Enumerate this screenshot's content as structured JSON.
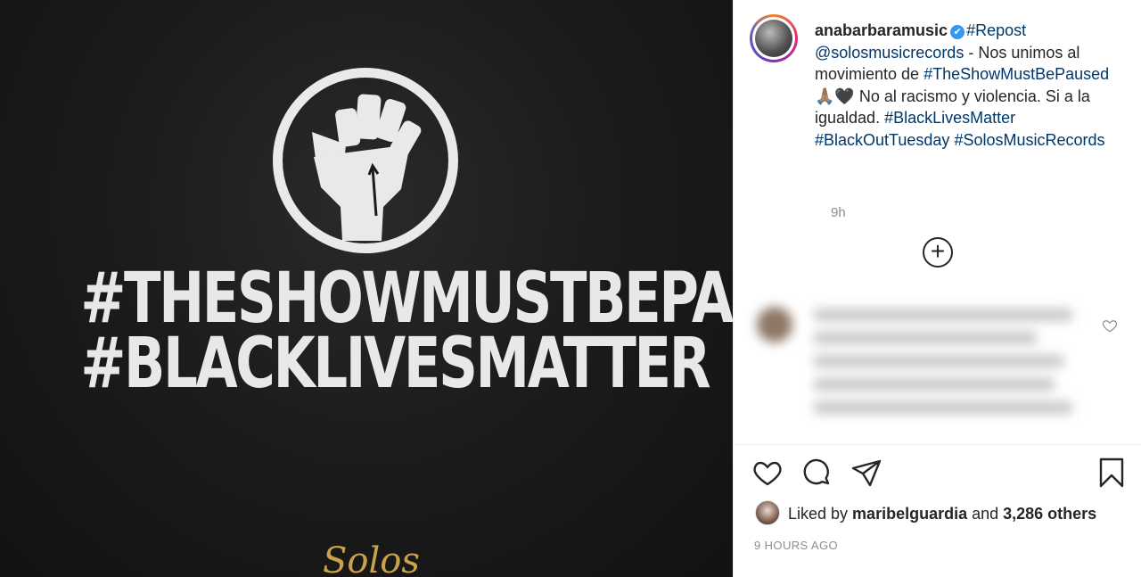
{
  "post_image": {
    "line1": "#THESHOWMUSTBEPAUSED",
    "line2": "#BLACKLIVESMATTER",
    "brand": "Solos"
  },
  "caption": {
    "username": "anabarbaramusic",
    "repost_tag": "#Repost",
    "mention": "@solosmusicrecords",
    "text1": " - Nos unimos al movimiento de ",
    "tag1": "#TheShowMustBePaused",
    "emoji": " 🙏🏽🖤 ",
    "text2": "No al racismo y violencia. Si a la igualdad. ",
    "tag2": "#BlackLivesMatter",
    "tag3": "#BlackOutTuesday",
    "tag4": "#SolosMusicRecords",
    "time": "9h"
  },
  "load_more_icon": "plus-circle-icon",
  "likes": {
    "prefix": "Liked by ",
    "user": "maribelguardia",
    "middle": " and ",
    "count": "3,286 others"
  },
  "timestamp": "9 HOURS AGO",
  "icons": [
    "heart-icon",
    "comment-icon",
    "share-icon",
    "bookmark-icon"
  ]
}
